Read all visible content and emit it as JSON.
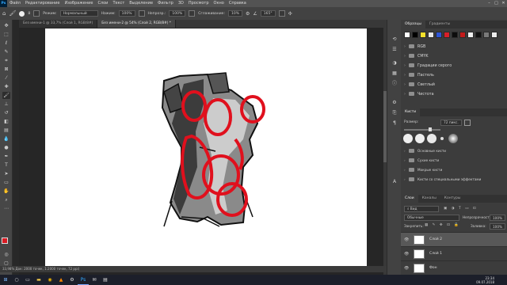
{
  "menubar": {
    "logo": "Ps",
    "items": [
      "Файл",
      "Редактирование",
      "Изображение",
      "Слои",
      "Текст",
      "Выделение",
      "Фильтр",
      "3D",
      "Просмотр",
      "Окно",
      "Справка"
    ],
    "window_buttons": [
      "–",
      "□",
      "✕"
    ]
  },
  "options": {
    "brush_size": "8",
    "mode_label": "Режим:",
    "mode_value": "Нормальный",
    "opacity_label": "Непрозр.:",
    "opacity_value": "100%",
    "flow_label": "Нажим:",
    "flow_value": "100%",
    "smoothing_label": "Сглаживание:",
    "smoothing_value": "10%",
    "angle_value": "165°"
  },
  "doc_tabs": [
    {
      "label": "Без имени-1 @ 33,7% (Слой 1, RGB/8#)",
      "active": false
    },
    {
      "label": "Без имени-2 @ 54% (Слой 2, RGB/8#) *",
      "active": true
    }
  ],
  "statusbar": {
    "text": "33,98%    Док: 2000 точек, 1:2000 точек, 72 ppi)"
  },
  "colors": {
    "foreground": "#d81b23",
    "background": "#ffffff",
    "sketch_red": "#e0101d",
    "panel_bg": "#3c3c3c"
  },
  "swatches_panel": {
    "tabs": [
      "Образцы",
      "Градиенты"
    ],
    "swatch_colors": [
      "#ffffff",
      "#000000",
      "#f4e12b",
      "#e5e5e5",
      "#2d55d6",
      "#d71f28",
      "#0d0d0d",
      "#c31b1b",
      "#f0f0f0",
      "#111111",
      "#7a7a7a",
      "#ededed"
    ],
    "groups": [
      "RGB",
      "CMYK",
      "Градации серого",
      "Пастель",
      "Светлый",
      "Чистота"
    ]
  },
  "brushes_panel": {
    "title": "Кисти",
    "size_label": "Размер:",
    "size_value": "72 пикс.",
    "groups": [
      "Основные кисти",
      "Сухие кисти",
      "Мокрые кисти",
      "Кисти со специальными эффектами"
    ]
  },
  "layers_panel": {
    "tabs": [
      "Слои",
      "Каналы",
      "Контуры"
    ],
    "kind_label": "Вид",
    "blend_mode": "Обычные",
    "opacity_label": "Непрозрачность:",
    "opacity_value": "100%",
    "lock_label": "Закрепить:",
    "fill_label": "Заливка:",
    "fill_value": "100%",
    "layers": [
      {
        "name": "Слой 2",
        "selected": true
      },
      {
        "name": "Слой 1",
        "selected": false
      },
      {
        "name": "Фон",
        "selected": false
      }
    ]
  },
  "taskbar": {
    "icons": [
      "windows-icon",
      "search-icon",
      "task-view-icon",
      "folder-icon",
      "chrome-icon",
      "vlc-icon",
      "steam-icon",
      "photoshop-icon",
      "mail-icon",
      "files-icon"
    ],
    "time": "23:34",
    "date": "09.07.2018"
  }
}
